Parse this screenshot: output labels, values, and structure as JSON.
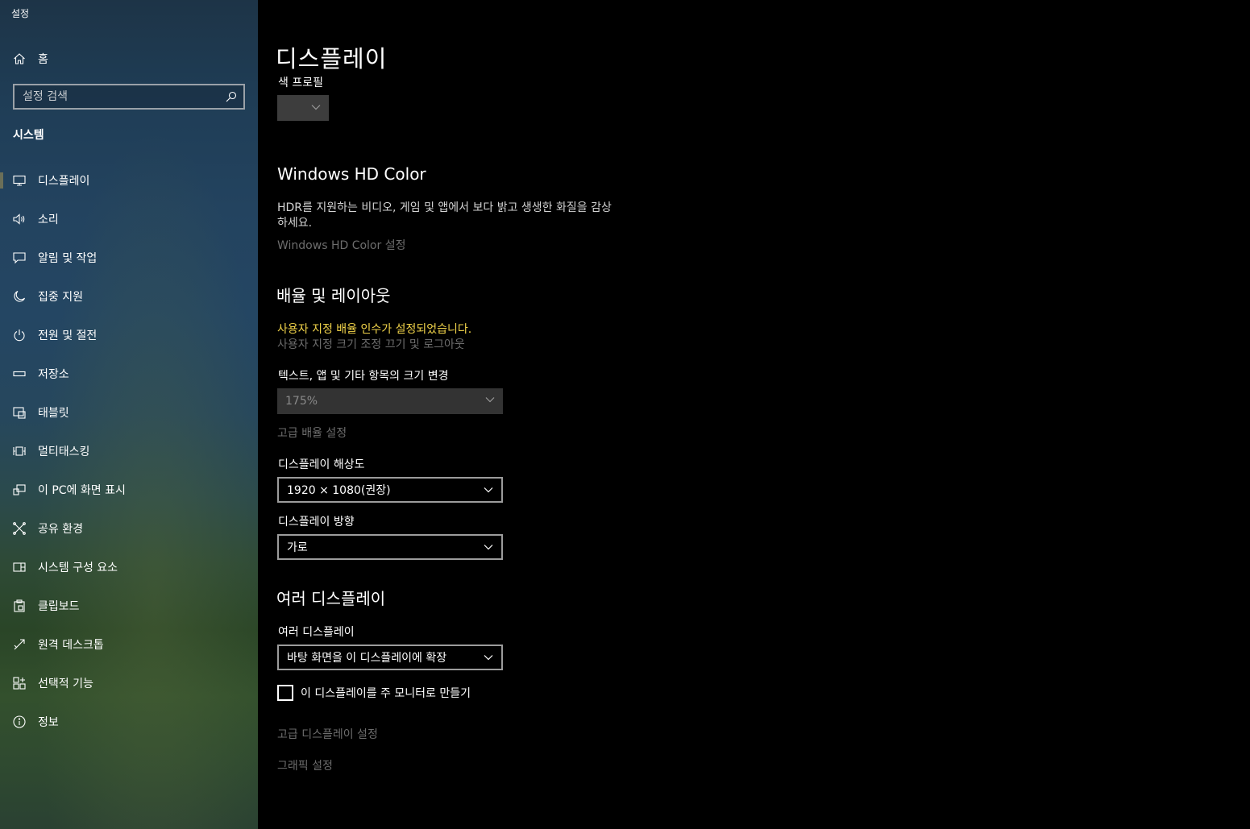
{
  "window": {
    "title": "설정"
  },
  "sidebar": {
    "home_label": "홈",
    "search_placeholder": "설정 검색",
    "section_label": "시스템",
    "items": [
      {
        "label": "디스플레이",
        "icon": "monitor-icon",
        "active": true
      },
      {
        "label": "소리",
        "icon": "speaker-icon"
      },
      {
        "label": "알림 및 작업",
        "icon": "notification-icon"
      },
      {
        "label": "집중 지원",
        "icon": "moon-icon"
      },
      {
        "label": "전원 및 절전",
        "icon": "power-icon"
      },
      {
        "label": "저장소",
        "icon": "storage-icon"
      },
      {
        "label": "태블릿",
        "icon": "tablet-icon"
      },
      {
        "label": "멀티태스킹",
        "icon": "multitasking-icon"
      },
      {
        "label": "이 PC에 화면 표시",
        "icon": "project-icon"
      },
      {
        "label": "공유 환경",
        "icon": "shared-experiences-icon"
      },
      {
        "label": "시스템 구성 요소",
        "icon": "components-icon"
      },
      {
        "label": "클립보드",
        "icon": "clipboard-icon"
      },
      {
        "label": "원격 데스크톱",
        "icon": "remote-desktop-icon"
      },
      {
        "label": "선택적 기능",
        "icon": "optional-features-icon"
      },
      {
        "label": "정보",
        "icon": "info-icon"
      }
    ]
  },
  "main": {
    "title": "디스플레이",
    "color_profile": {
      "label": "색 프로필"
    },
    "hd_color": {
      "heading": "Windows HD Color",
      "description_line1": "HDR를 지원하는 비디오, 게임 및 앱에서 보다 밝고 생생한 화질을 감상",
      "description_line2": "하세요.",
      "settings_link": "Windows HD Color 설정"
    },
    "scale_layout": {
      "heading": "배율 및 레이아웃",
      "warning": "사용자 지정 배율 인수가 설정되었습니다.",
      "signout_link": "사용자 지정 크기 조정 끄기 및 로그아웃",
      "size_label": "텍스트, 앱 및 기타 항목의 크기 변경",
      "size_value": "175%",
      "advanced_scaling_link": "고급 배율 설정",
      "resolution_label": "디스플레이 해상도",
      "resolution_value": "1920 × 1080(권장)",
      "orientation_label": "디스플레이 방향",
      "orientation_value": "가로"
    },
    "multi_display": {
      "heading": "여러 디스플레이",
      "label": "여러 디스플레이",
      "value": "바탕 화면을 이 디스플레이에 확장",
      "main_monitor_checkbox": "이 디스플레이를 주 모니터로 만들기",
      "main_monitor_checked": false,
      "advanced_display_link": "고급 디스플레이 설정",
      "graphics_link": "그래픽 설정"
    }
  },
  "colors": {
    "warning": "#f2d44a",
    "dim_link": "#6d6d6d",
    "dropdown_border": "#9c9c9c"
  }
}
